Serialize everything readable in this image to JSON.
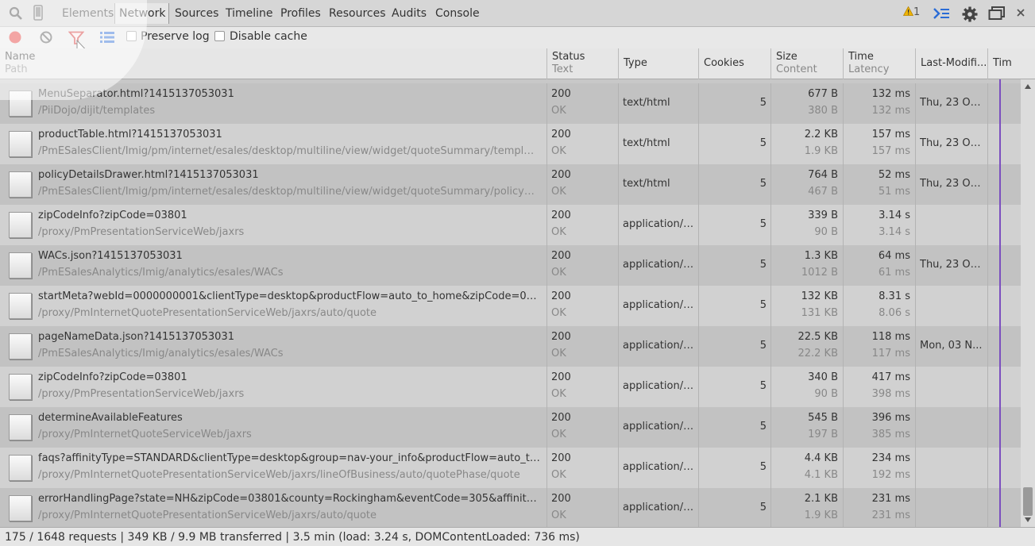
{
  "tabs": [
    "Elements",
    "Network",
    "Sources",
    "Timeline",
    "Profiles",
    "Resources",
    "Audits",
    "Console"
  ],
  "warning_count": "1",
  "toolbar": {
    "preserve_log": "Preserve log",
    "disable_cache": "Disable cache"
  },
  "columns": {
    "name": "Name",
    "path": "Path",
    "status": "Status",
    "text": "Text",
    "type": "Type",
    "cookies": "Cookies",
    "size": "Size",
    "content": "Content",
    "time": "Time",
    "latency": "Latency",
    "last_modified": "Last-Modifi...",
    "timeline": "Tim"
  },
  "rows": [
    {
      "name": "MenuSeparator.html?1415137053031",
      "path": "/PiiDojo/dijit/templates",
      "status": "200",
      "text": "OK",
      "type": "text/html",
      "cookies": "5",
      "size": "677 B",
      "content": "380 B",
      "time": "132 ms",
      "latency": "132 ms",
      "modified": "Thu, 23 Oct..."
    },
    {
      "name": "productTable.html?1415137053031",
      "path": "/PmESalesClient/Imig/pm/internet/esales/desktop/multiline/view/widget/quoteSummary/template",
      "status": "200",
      "text": "OK",
      "type": "text/html",
      "cookies": "5",
      "size": "2.2 KB",
      "content": "1.9 KB",
      "time": "157 ms",
      "latency": "157 ms",
      "modified": "Thu, 23 Oct..."
    },
    {
      "name": "policyDetailsDrawer.html?1415137053031",
      "path": "/PmESalesClient/Imig/pm/internet/esales/desktop/multiline/view/widget/quoteSummary/policyDetails...",
      "status": "200",
      "text": "OK",
      "type": "text/html",
      "cookies": "5",
      "size": "764 B",
      "content": "467 B",
      "time": "52 ms",
      "latency": "51 ms",
      "modified": "Thu, 23 Oct..."
    },
    {
      "name": "zipCodeInfo?zipCode=03801",
      "path": "/proxy/PmPresentationServiceWeb/jaxrs",
      "status": "200",
      "text": "OK",
      "type": "application/j...",
      "cookies": "5",
      "size": "339 B",
      "content": "90 B",
      "time": "3.14 s",
      "latency": "3.14 s",
      "modified": ""
    },
    {
      "name": "WACs.json?1415137053031",
      "path": "/PmESalesAnalytics/Imig/analytics/esales/WACs",
      "status": "200",
      "text": "OK",
      "type": "application/j...",
      "cookies": "5",
      "size": "1.3 KB",
      "content": "1012 B",
      "time": "64 ms",
      "latency": "61 ms",
      "modified": "Thu, 23 Oct..."
    },
    {
      "name": "startMeta?webId=0000000001&clientType=desktop&productFlow=auto_to_home&zipCode=03801&...",
      "path": "/proxy/PmInternetQuotePresentationServiceWeb/jaxrs/auto/quote",
      "status": "200",
      "text": "OK",
      "type": "application/j...",
      "cookies": "5",
      "size": "132 KB",
      "content": "131 KB",
      "time": "8.31 s",
      "latency": "8.06 s",
      "modified": ""
    },
    {
      "name": "pageNameData.json?1415137053031",
      "path": "/PmESalesAnalytics/Imig/analytics/esales/WACs",
      "status": "200",
      "text": "OK",
      "type": "application/j...",
      "cookies": "5",
      "size": "22.5 KB",
      "content": "22.2 KB",
      "time": "118 ms",
      "latency": "117 ms",
      "modified": "Mon, 03 N..."
    },
    {
      "name": "zipCodeInfo?zipCode=03801",
      "path": "/proxy/PmPresentationServiceWeb/jaxrs",
      "status": "200",
      "text": "OK",
      "type": "application/j...",
      "cookies": "5",
      "size": "340 B",
      "content": "90 B",
      "time": "417 ms",
      "latency": "398 ms",
      "modified": ""
    },
    {
      "name": "determineAvailableFeatures",
      "path": "/proxy/PmInternetQuoteServiceWeb/jaxrs",
      "status": "200",
      "text": "OK",
      "type": "application/j...",
      "cookies": "5",
      "size": "545 B",
      "content": "197 B",
      "time": "396 ms",
      "latency": "385 ms",
      "modified": ""
    },
    {
      "name": "faqs?affinityType=STANDARD&clientType=desktop&group=nav-your_info&productFlow=auto_to_ho...",
      "path": "/proxy/PmInternetQuotePresentationServiceWeb/jaxrs/lineOfBusiness/auto/quotePhase/quote",
      "status": "200",
      "text": "OK",
      "type": "application/j...",
      "cookies": "5",
      "size": "4.4 KB",
      "content": "4.1 KB",
      "time": "234 ms",
      "latency": "192 ms",
      "modified": ""
    },
    {
      "name": "errorHandlingPage?state=NH&zipCode=03801&county=Rockingham&eventCode=305&affinityType=...",
      "path": "/proxy/PmInternetQuotePresentationServiceWeb/jaxrs/auto/quote",
      "status": "200",
      "text": "OK",
      "type": "application/j...",
      "cookies": "5",
      "size": "2.1 KB",
      "content": "1.9 KB",
      "time": "231 ms",
      "latency": "231 ms",
      "modified": ""
    }
  ],
  "status_bar": "175 / 1648 requests | 349 KB / 9.9 MB transferred | 3.5 min (load: 3.24 s, DOMContentLoaded: 736 ms)",
  "colors": {
    "record": "#e53935",
    "filter": "#d32f2f",
    "accent": "#2b6cd6",
    "timeline_line": "#7b4fbf"
  }
}
